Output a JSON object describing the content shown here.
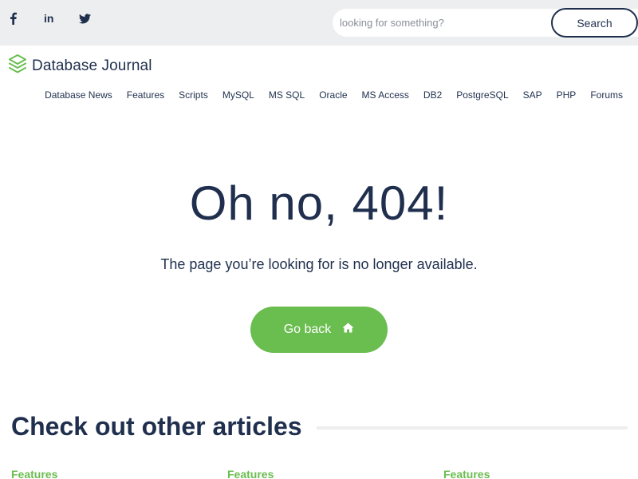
{
  "topbar": {
    "social": [
      {
        "name": "facebook-icon",
        "glyph": "f"
      },
      {
        "name": "linkedin-icon",
        "glyph": "in"
      },
      {
        "name": "twitter-icon",
        "glyph": ""
      }
    ],
    "search": {
      "placeholder": "looking for something?",
      "button_label": "Search"
    }
  },
  "header": {
    "logo_text": "Database Journal",
    "logo_icon": "layers-icon"
  },
  "nav": {
    "items": [
      "Database News",
      "Features",
      "Scripts",
      "MySQL",
      "MS SQL",
      "Oracle",
      "MS Access",
      "DB2",
      "PostgreSQL",
      "SAP",
      "PHP",
      "Forums"
    ]
  },
  "main": {
    "title": "Oh no, 404!",
    "message": "The page you’re looking for is no longer available.",
    "button_label": "Go back",
    "button_icon": "home-icon"
  },
  "articles": {
    "heading": "Check out other articles",
    "categories": [
      "Features",
      "Features",
      "Features"
    ]
  },
  "colors": {
    "text_dark": "#1f2f4d",
    "accent_green": "#6abd4f",
    "topbar_bg": "#edeef0"
  }
}
